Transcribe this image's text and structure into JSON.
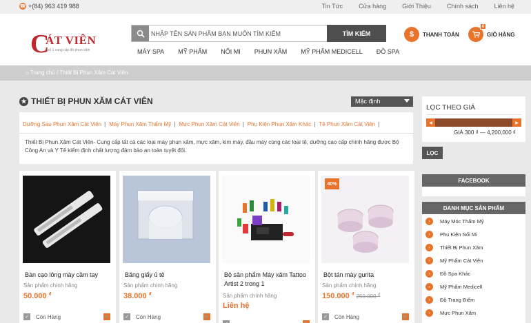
{
  "topbar": {
    "phone": "+(84) 963 419 988",
    "nav": [
      "Tin Tức",
      "Cửa hàng",
      "Giới Thiệu",
      "Chính sách",
      "Liên hệ"
    ]
  },
  "logo": {
    "letter": "C",
    "name": "ÁT VIÊN",
    "slogan": "số 1 cung cấp đồ phun xăm"
  },
  "search": {
    "placeholder": "NHẬP TÊN SẢN PHẨM BẠN MUỐN TÌM KIẾM",
    "button": "TÌM KIẾM"
  },
  "main_nav": [
    "MÁY SPA",
    "MỸ PHẨM",
    "NỐI MI",
    "PHUN XĂM",
    "MỸ PHẨM MEDICELL",
    "ĐỒ SPA"
  ],
  "header_actions": {
    "checkout": "THANH TOÁN",
    "cart": "GIỎ HÀNG",
    "cart_count": "0"
  },
  "breadcrumb": {
    "home": "Trang chủ",
    "separator": "/",
    "current": "Thiết Bị Phun Xăm Cát Viên"
  },
  "page": {
    "title": "THIẾT BỊ PHUN XĂM CÁT VIÊN",
    "sort": "Mặc định",
    "category_links": [
      "Dưỡng Sau Phun Xăm Cát Viên",
      "Máy Phun Xăm Thẩm Mỹ",
      "Mực Phun Xăm Cát Viên",
      "Phụ Kiện Phun Xăm Khác",
      "Tê Phun Xăm Cát Viên"
    ],
    "description": "Thiết Bị Phun Xăm Cát Viên- Cung cấp tất cả các loại máy phun xăm, mực xăm, kim máy, đầu máy cùng các loại tê, dưỡng cao cấp chính hãng được Bộ Công An và Y Tế kiểm định chất lượng đảm bảo an toàn tuyệt đối."
  },
  "products": [
    {
      "name": "Bàn cạo lông mày cầm tay",
      "sub": "Sản phẩm chính hãng",
      "price": "50.000",
      "currency": "đ",
      "stock": "Còn Hàng"
    },
    {
      "name": "Băng giấy ủ tê",
      "sub": "Sản phẩm chính hãng",
      "price": "38.000",
      "currency": "đ",
      "stock": "Còn Hàng"
    },
    {
      "name": "Bộ sản phẩm Máy xăm Tattoo Artist 2 trong 1",
      "sub": "Sản phẩm chính hãng",
      "price": "Liên hệ",
      "stock": ""
    },
    {
      "name": "Bột tán mày gurita",
      "sub": "Sản phẩm chính hãng",
      "price": "150.000",
      "currency": "đ",
      "old_price": "250.000",
      "old_currency": "đ",
      "sale": "40%",
      "stock": "Còn Hàng"
    }
  ],
  "sidebar": {
    "filter_title": "LỌC THEO GIÁ",
    "price_range": "GIÁ 300 ₫ — 4,200,000 ₫",
    "filter_button": "LỌC",
    "facebook": "FACEBOOK",
    "categories_title": "DANH MỤC SẢN PHẨM",
    "categories": [
      "Máy Móc Thẩm Mỹ",
      "Phụ Kiện Nối Mi",
      "Thiết Bị Phun Xăm",
      "Mỹ Phẩm Cát Viên",
      "Đồ Spa Khác",
      "Mỹ Phẩm Medicell",
      "Đồ Trang Điểm",
      "Mực Phun Xăm"
    ]
  },
  "colors": {
    "accent": "#e8732b",
    "brand": "#c0272d",
    "dark": "#4e4e4e"
  }
}
